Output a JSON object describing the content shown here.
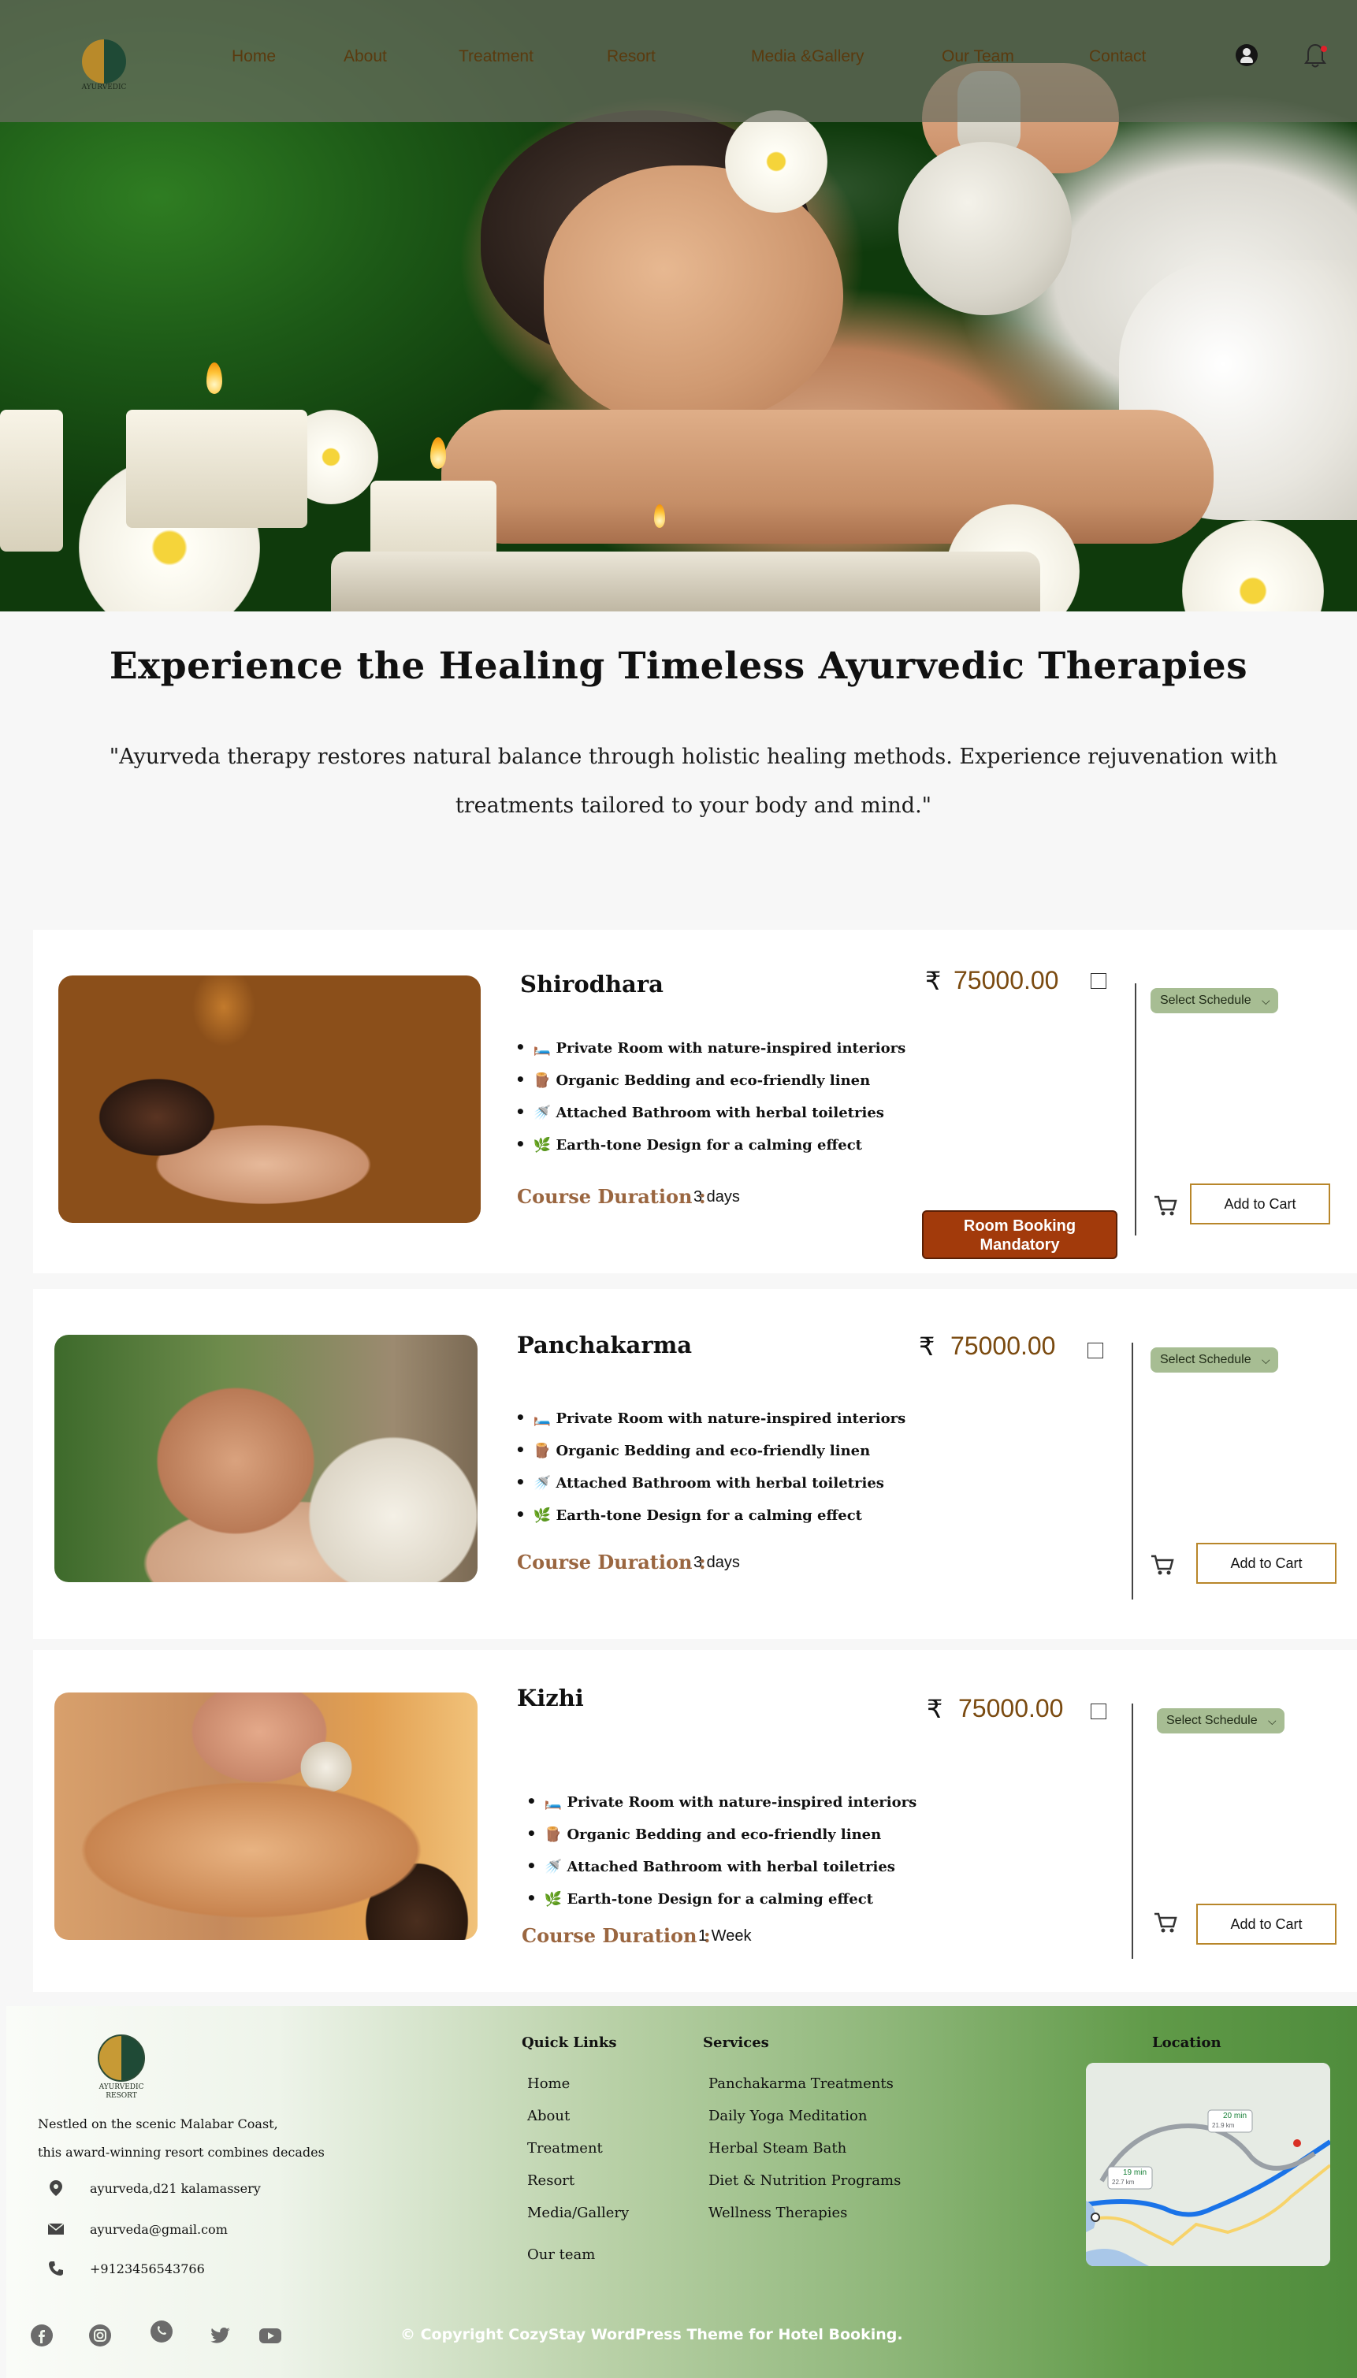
{
  "nav": {
    "logo_text": "AYURVEDIC",
    "items": [
      "Home",
      "About",
      "Treatment",
      "Resort",
      "Media &Gallery",
      "Our Team",
      "Contact"
    ]
  },
  "intro": {
    "title": "Experience the Healing  Timeless Ayurvedic Therapies",
    "quote": "\"Ayurveda therapy restores natural balance through holistic healing methods. Experience rejuvenation with  treatments tailored to your body and mind.\""
  },
  "cards": [
    {
      "name": "Shirodhara",
      "currency": "₹",
      "price": "75000.00",
      "features": [
        "🛏️ Private Room with nature-inspired interiors",
        "🪵 Organic Bedding and eco-friendly linen",
        "🚿 Attached Bathroom with herbal toiletries",
        "🌿 Earth-tone Design for a calming effect"
      ],
      "duration_label": "Course Duration :",
      "duration": "3 days",
      "schedule_label": "Select Schedule",
      "add_to_cart": "Add to Cart",
      "room_booking": "Room Booking Mandatory"
    },
    {
      "name": "Panchakarma",
      "currency": "₹",
      "price": "75000.00",
      "features": [
        "🛏️ Private Room with nature-inspired interiors",
        "🪵 Organic Bedding and eco-friendly linen",
        "🚿 Attached Bathroom with herbal toiletries",
        "🌿 Earth-tone Design for a calming effect"
      ],
      "duration_label": "Course Duration :",
      "duration": "3 days",
      "schedule_label": "Select Schedule",
      "add_to_cart": "Add to Cart"
    },
    {
      "name": "Kizhi",
      "currency": "₹",
      "price": "75000.00",
      "features": [
        "🛏️ Private Room with nature-inspired interiors",
        "🪵 Organic Bedding and eco-friendly linen",
        "🚿 Attached Bathroom with herbal toiletries",
        "🌿 Earth-tone Design for a calming effect"
      ],
      "duration_label": "Course Duration :",
      "duration": "1 Week",
      "schedule_label": "Select Schedule",
      "add_to_cart": "Add to Cart"
    }
  ],
  "footer": {
    "logo_text": "AYURVEDIC RESORT",
    "about_lines": [
      "Nestled on the scenic Malabar Coast,",
      "this award-winning resort combines decades"
    ],
    "address": "ayurveda,d21 kalamassery",
    "email": "ayurveda@gmail.com",
    "phone": "+9123456543766",
    "quick_links_title": "Quick Links",
    "quick_links": [
      "Home",
      "About",
      "Treatment",
      "Resort",
      "Media/Gallery",
      "Our team"
    ],
    "services_title": "Services",
    "services": [
      "Panchakarma Treatments",
      "Daily Yoga  Meditation",
      "Herbal Steam Bath",
      "Diet & Nutrition Programs",
      "Wellness Therapies"
    ],
    "location_title": "Location",
    "map_labels": [
      "20 min",
      "21.9 km",
      "19 min",
      "22.7 km"
    ],
    "copyright": "© Copyright CozyStay WordPress Theme for Hotel Booking.",
    "social_icons": [
      "facebook-icon",
      "instagram-icon",
      "whatsapp-icon",
      "twitter-icon",
      "youtube-icon"
    ]
  },
  "colors": {
    "accent_brown": "#7a4a10",
    "duration_label": "#9a6640",
    "schedule_button": "#a7bd93",
    "room_booking_button": "#a23a0b",
    "add_to_cart_border": "#b8862a",
    "footer_green": "#4f8c3c"
  }
}
